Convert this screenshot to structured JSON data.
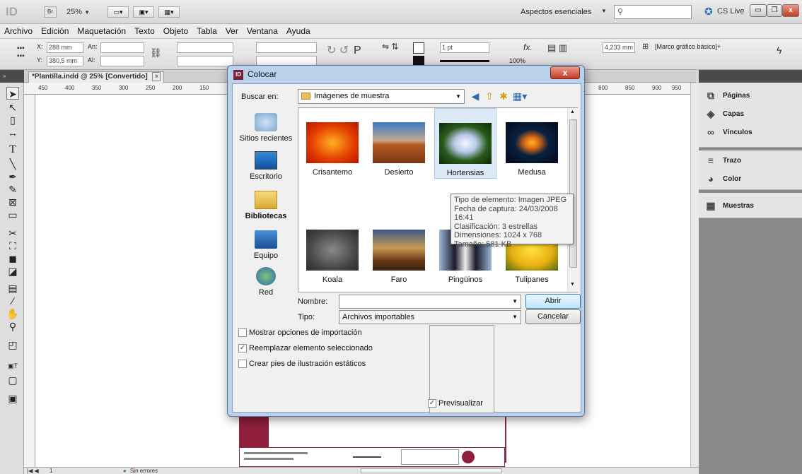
{
  "app": {
    "logo": "ID",
    "bridge": "Br",
    "zoom": "25%",
    "workspace": "Aspectos esenciales",
    "cslive": "CS Live"
  },
  "menu": [
    "Archivo",
    "Edición",
    "Maquetación",
    "Texto",
    "Objeto",
    "Tabla",
    "Ver",
    "Ventana",
    "Ayuda"
  ],
  "control": {
    "x_label": "X:",
    "x_value": "288 mm",
    "y_label": "Y:",
    "y_value": "380,5 mm",
    "w_label": "An:",
    "h_label": "Al:",
    "stroke_weight": "1 pt",
    "opacity": "100%",
    "dimension": "4,233 mm",
    "frame_style": "[Marco gráfico básico]+"
  },
  "document": {
    "tab": "*Plantilla.indd @ 25% [Convertido]",
    "ruler_marks": [
      "450",
      "400",
      "350",
      "300",
      "250",
      "200",
      "150",
      "100",
      "50"
    ],
    "ruler_marks_right": [
      "800",
      "850",
      "900",
      "950",
      "10"
    ],
    "page_num": "1",
    "status": "Sin errores"
  },
  "panels": {
    "group1": [
      "Páginas",
      "Capas",
      "Vínculos"
    ],
    "group2": [
      "Trazo",
      "Color"
    ],
    "group3": [
      "Muestras"
    ]
  },
  "dialog": {
    "title": "Colocar",
    "lookin_label": "Buscar en:",
    "lookin_value": "Imágenes de muestra",
    "places": [
      "Sitios recientes",
      "Escritorio",
      "Bibliotecas",
      "Equipo",
      "Red"
    ],
    "files": [
      "Crisantemo",
      "Desierto",
      "Hortensias",
      "Medusa",
      "Koala",
      "Faro",
      "Pingüinos",
      "Tulipanes"
    ],
    "tooltip": [
      "Tipo de elemento: Imagen JPEG",
      "Fecha de captura: 24/03/2008 16:41",
      "Clasificación: 3 estrellas",
      "Dimensiones: 1024 x 768",
      "Tamaño: 581 KB"
    ],
    "name_label": "Nombre:",
    "name_value": "",
    "type_label": "Tipo:",
    "type_value": "Archivos importables",
    "open_button": "Abrir",
    "cancel_button": "Cancelar",
    "opt_import": "Mostrar opciones de importación",
    "opt_replace": "Reemplazar elemento seleccionado",
    "opt_captions": "Crear pies de ilustración estáticos",
    "opt_preview": "Previsualizar",
    "checked": {
      "import": false,
      "replace": true,
      "captions": false,
      "preview": true
    }
  }
}
